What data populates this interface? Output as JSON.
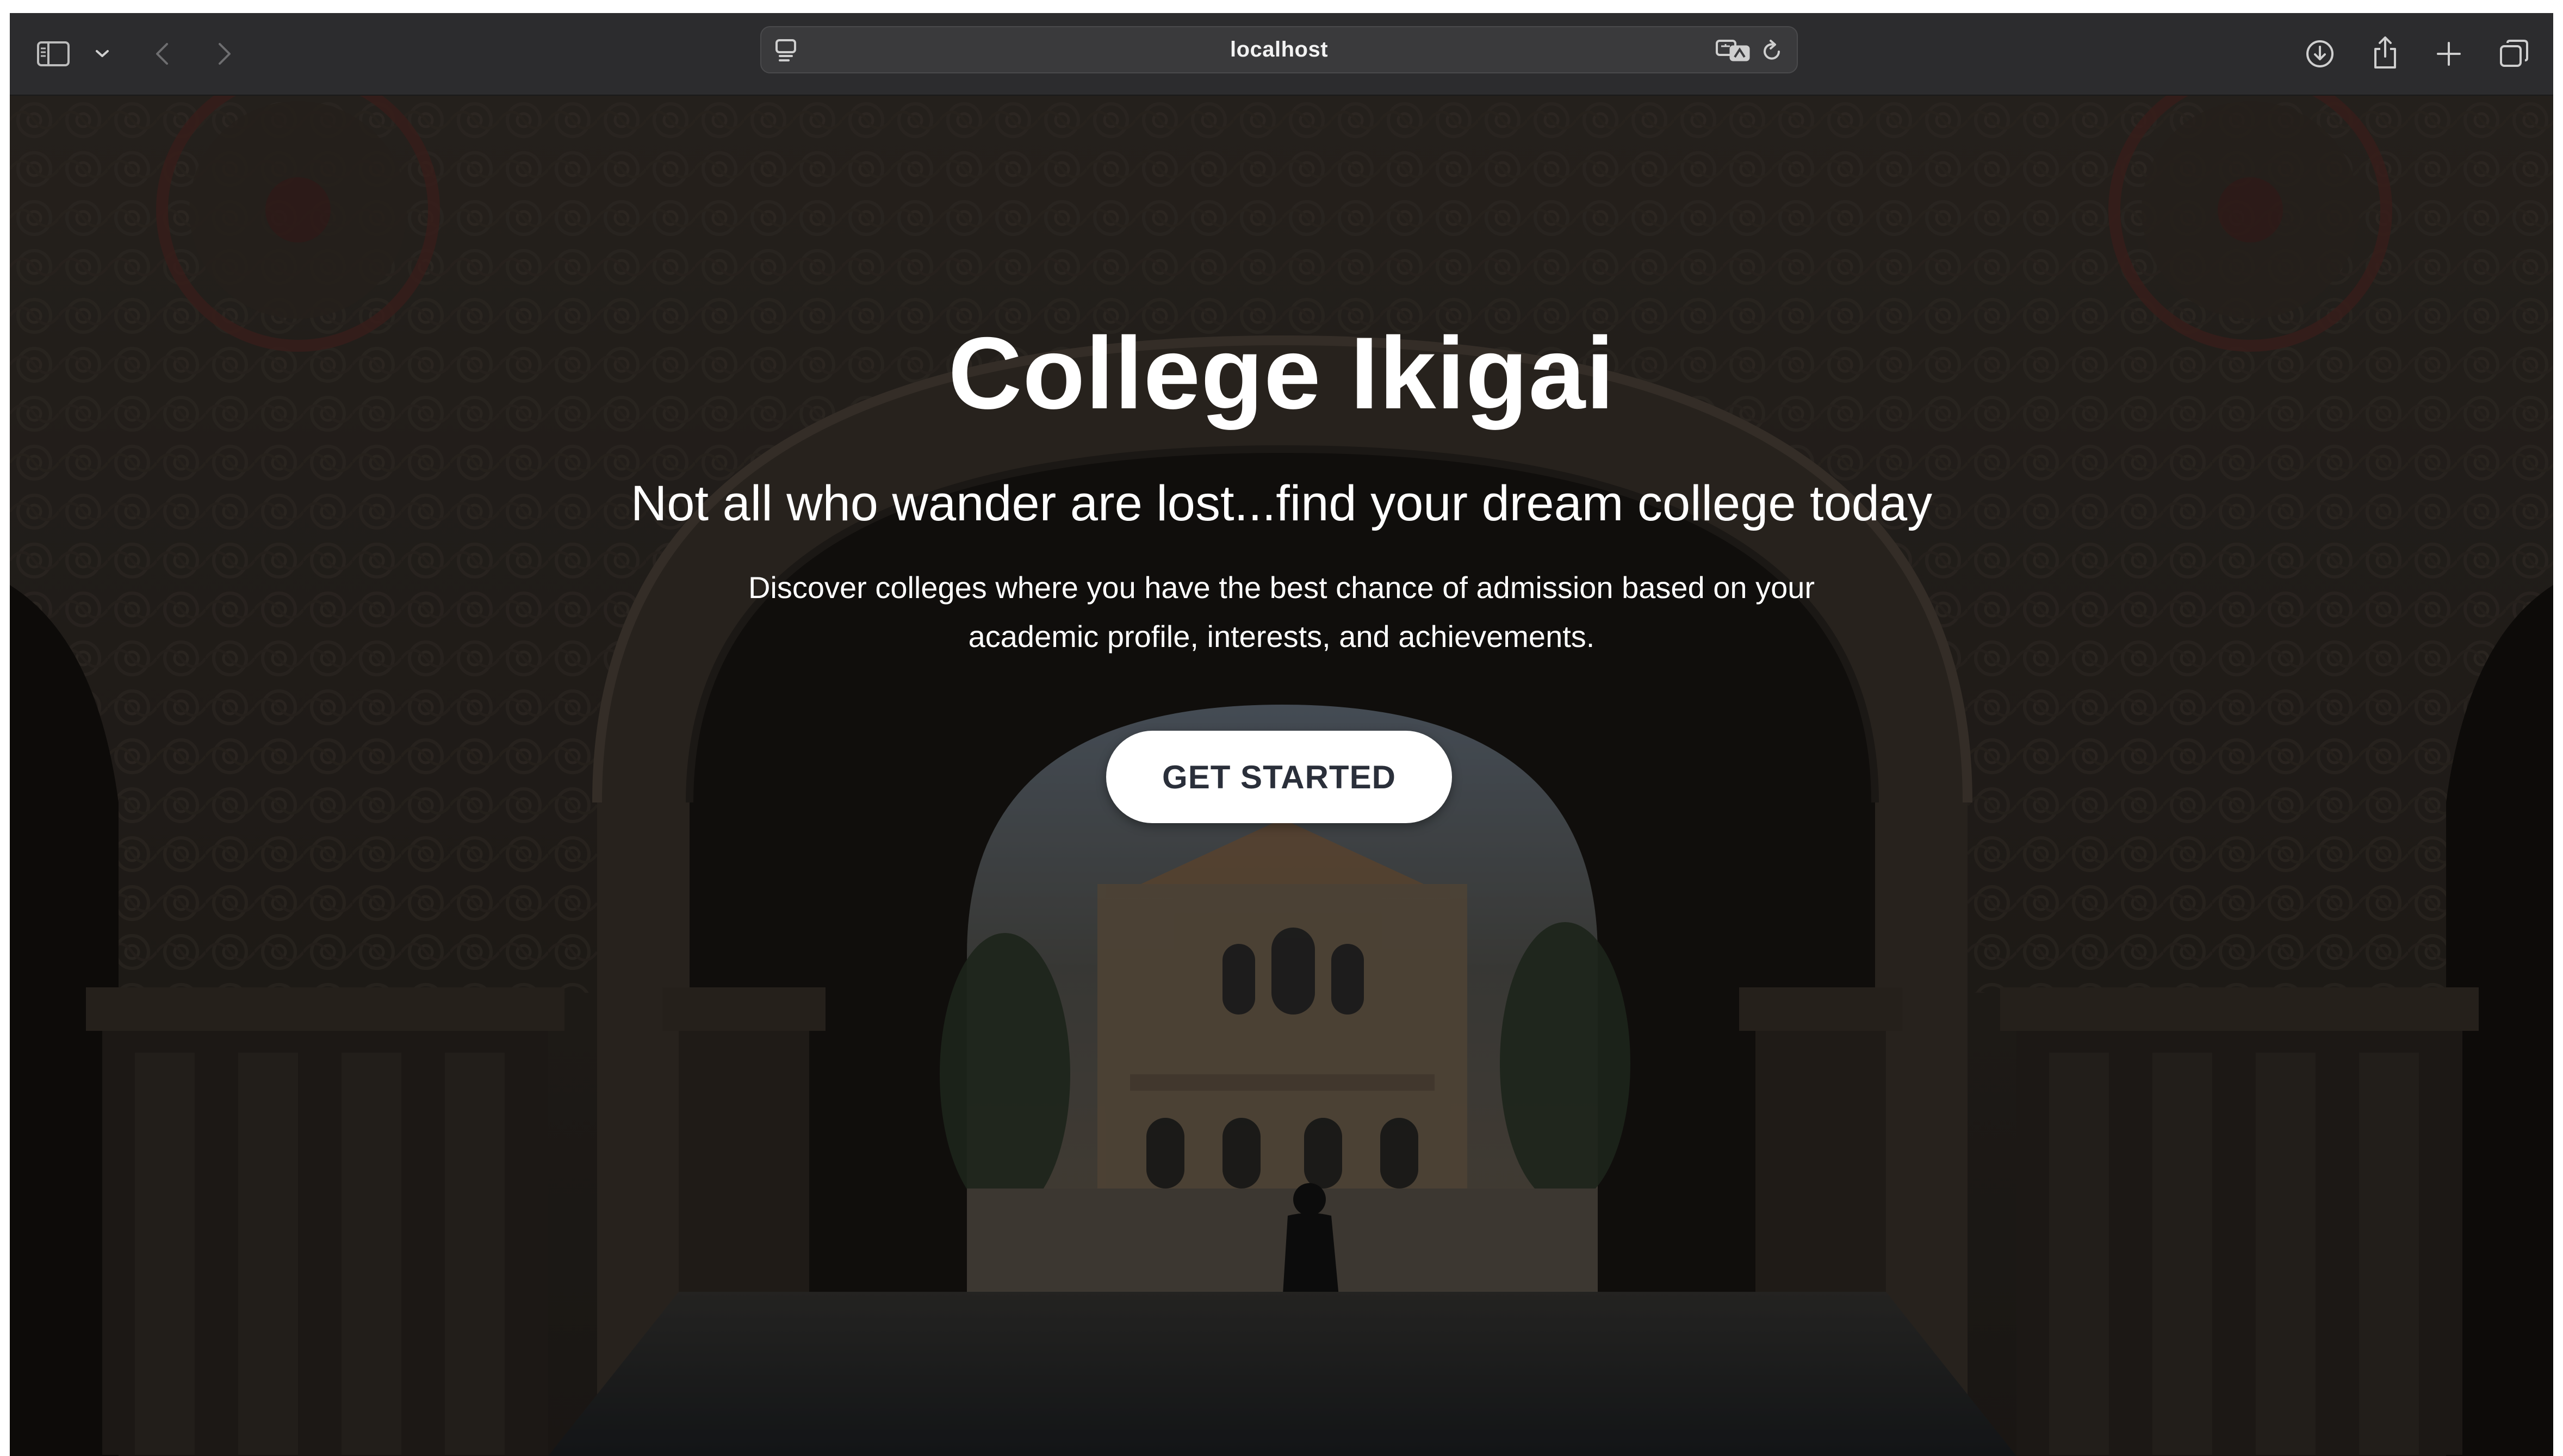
{
  "browser": {
    "address": "localhost",
    "icons": {
      "sidebar": "sidebar-icon",
      "sidebar_menu": "chevron-down-icon",
      "back": "chevron-left-icon",
      "forward": "chevron-right-icon",
      "page_menu": "page-menu-icon",
      "translate": "translate-icon",
      "reload": "reload-icon",
      "downloads": "download-icon",
      "share": "share-icon",
      "new_tab": "plus-icon",
      "tab_overview": "tabs-overview-icon"
    }
  },
  "hero": {
    "title": "College Ikigai",
    "subtitle": "Not all who wander are lost...find your dream college today",
    "description": "Discover colleges where you have the best chance of admission based on your academic profile, interests, and achievements.",
    "cta_label": "GET STARTED"
  },
  "colors": {
    "toolbar": "#2c2c2e",
    "address_bar": "#3a3a3c",
    "text_light": "#ffffff",
    "cta_bg": "#ffffff",
    "cta_text": "#2a2f3a"
  }
}
